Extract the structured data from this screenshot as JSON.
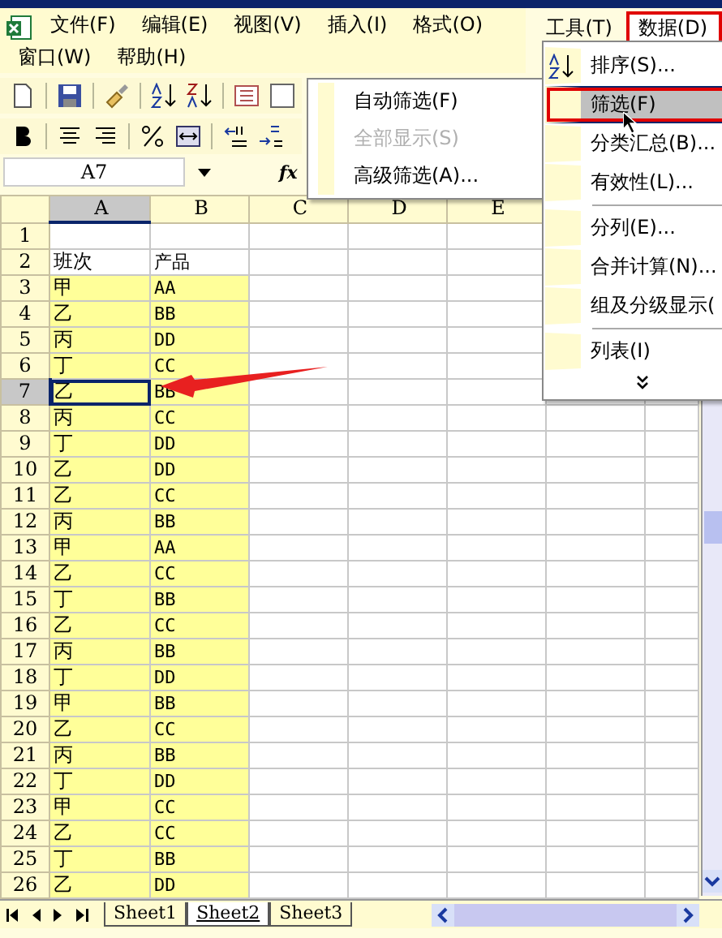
{
  "menu_bar": [
    {
      "label": "文件(F)",
      "selected": false,
      "annotated": false
    },
    {
      "label": "编辑(E)",
      "selected": false,
      "annotated": false
    },
    {
      "label": "视图(V)",
      "selected": false,
      "annotated": false
    },
    {
      "label": "插入(I)",
      "selected": false,
      "annotated": false
    },
    {
      "label": "格式(O)",
      "selected": false,
      "annotated": false
    },
    {
      "label": "工具(T)",
      "selected": false,
      "annotated": false
    },
    {
      "label": "数据(D)",
      "selected": true,
      "annotated": true
    },
    {
      "label": "窗口(W)",
      "selected": false,
      "annotated": false
    },
    {
      "label": "帮助(H)",
      "selected": false,
      "annotated": false
    }
  ],
  "formula_bar": {
    "name_box": "A7",
    "fx": "fx"
  },
  "columns": [
    {
      "label": "A",
      "selected": true
    },
    {
      "label": "B",
      "selected": false
    },
    {
      "label": "C",
      "selected": false
    },
    {
      "label": "D",
      "selected": false
    },
    {
      "label": "E",
      "selected": false
    }
  ],
  "rows": [
    {
      "number": "1",
      "selected": false,
      "filled": false
    },
    {
      "number": "2",
      "a": "班次",
      "b": "产品",
      "selected": false,
      "filled": false
    },
    {
      "number": "3",
      "a": "甲",
      "b": "AA",
      "selected": false,
      "filled": true
    },
    {
      "number": "4",
      "a": "乙",
      "b": "BB",
      "selected": false,
      "filled": true
    },
    {
      "number": "5",
      "a": "丙",
      "b": "DD",
      "selected": false,
      "filled": true
    },
    {
      "number": "6",
      "a": "丁",
      "b": "CC",
      "selected": false,
      "filled": true
    },
    {
      "number": "7",
      "a": "乙",
      "b": "BB",
      "selected": true,
      "filled": true
    },
    {
      "number": "8",
      "a": "丙",
      "b": "CC",
      "selected": false,
      "filled": true
    },
    {
      "number": "9",
      "a": "丁",
      "b": "DD",
      "selected": false,
      "filled": true
    },
    {
      "number": "10",
      "a": "乙",
      "b": "DD",
      "selected": false,
      "filled": true
    },
    {
      "number": "11",
      "a": "乙",
      "b": "CC",
      "selected": false,
      "filled": true
    },
    {
      "number": "12",
      "a": "丙",
      "b": "BB",
      "selected": false,
      "filled": true
    },
    {
      "number": "13",
      "a": "甲",
      "b": "AA",
      "selected": false,
      "filled": true
    },
    {
      "number": "14",
      "a": "乙",
      "b": "CC",
      "selected": false,
      "filled": true
    },
    {
      "number": "15",
      "a": "丁",
      "b": "BB",
      "selected": false,
      "filled": true
    },
    {
      "number": "16",
      "a": "乙",
      "b": "CC",
      "selected": false,
      "filled": true
    },
    {
      "number": "17",
      "a": "丙",
      "b": "BB",
      "selected": false,
      "filled": true
    },
    {
      "number": "18",
      "a": "丁",
      "b": "DD",
      "selected": false,
      "filled": true
    },
    {
      "number": "19",
      "a": "甲",
      "b": "BB",
      "selected": false,
      "filled": true
    },
    {
      "number": "20",
      "a": "乙",
      "b": "CC",
      "selected": false,
      "filled": true
    },
    {
      "number": "21",
      "a": "丙",
      "b": "BB",
      "selected": false,
      "filled": true
    },
    {
      "number": "22",
      "a": "丁",
      "b": "DD",
      "selected": false,
      "filled": true
    },
    {
      "number": "23",
      "a": "甲",
      "b": "CC",
      "selected": false,
      "filled": true
    },
    {
      "number": "24",
      "a": "乙",
      "b": "CC",
      "selected": false,
      "filled": true
    },
    {
      "number": "25",
      "a": "丁",
      "b": "BB",
      "selected": false,
      "filled": true
    },
    {
      "number": "26",
      "a": "乙",
      "b": "DD",
      "selected": false,
      "filled": true
    }
  ],
  "data_menu": [
    {
      "kind": "sort",
      "label": "排序(S)...",
      "selected": false,
      "annotated": false
    },
    {
      "kind": "item",
      "label": "筛选(F)",
      "selected": true,
      "annotated": true
    },
    {
      "kind": "item",
      "label": "分类汇总(B)...",
      "selected": false,
      "annotated": false
    },
    {
      "kind": "item",
      "label": "有效性(L)...",
      "selected": false,
      "annotated": false
    },
    {
      "kind": "separator"
    },
    {
      "kind": "item",
      "label": "分列(E)...",
      "selected": false,
      "annotated": false
    },
    {
      "kind": "item",
      "label": "合并计算(N)...",
      "selected": false,
      "annotated": false
    },
    {
      "kind": "item",
      "label": "组及分级显示(",
      "selected": false,
      "annotated": false
    },
    {
      "kind": "separator"
    },
    {
      "kind": "item",
      "label": "列表(I)",
      "selected": false,
      "annotated": false
    },
    {
      "kind": "more"
    }
  ],
  "filter_submenu": [
    {
      "label": "自动筛选(F)",
      "disabled": false
    },
    {
      "label": "全部显示(S)",
      "disabled": true
    },
    {
      "label": "高级筛选(A)...",
      "disabled": false
    }
  ],
  "sheet_tabs": [
    {
      "label": "Sheet1",
      "selected": false
    },
    {
      "label": "Sheet2",
      "selected": true
    },
    {
      "label": "Sheet3",
      "selected": false
    }
  ]
}
